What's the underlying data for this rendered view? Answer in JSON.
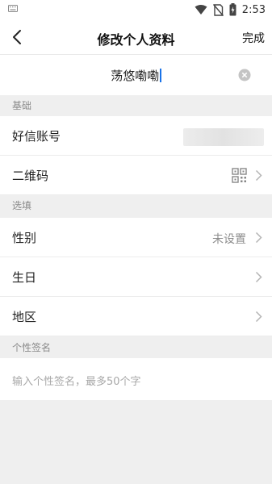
{
  "status_bar": {
    "time": "2:53",
    "icons": [
      "keyboard-icon",
      "wifi-icon",
      "no-sim-icon",
      "battery-charging-icon"
    ]
  },
  "nav": {
    "title": "修改个人资料",
    "done_label": "完成",
    "back_icon": "back-arrow-icon"
  },
  "name": {
    "value": "荡悠嘞嘞",
    "clear_icon": "clear-icon"
  },
  "sections": {
    "basic": {
      "header": "基础",
      "account_label": "好信账号",
      "qrcode_label": "二维码"
    },
    "optional": {
      "header": "选填",
      "gender_label": "性别",
      "gender_value": "未设置",
      "birthday_label": "生日",
      "region_label": "地区"
    },
    "signature": {
      "header": "个性签名",
      "placeholder": "输入个性签名，最多50个字"
    }
  },
  "colors": {
    "background": "#efefef",
    "caret": "#1a73e8",
    "secondary_text": "#8c8c8c"
  }
}
